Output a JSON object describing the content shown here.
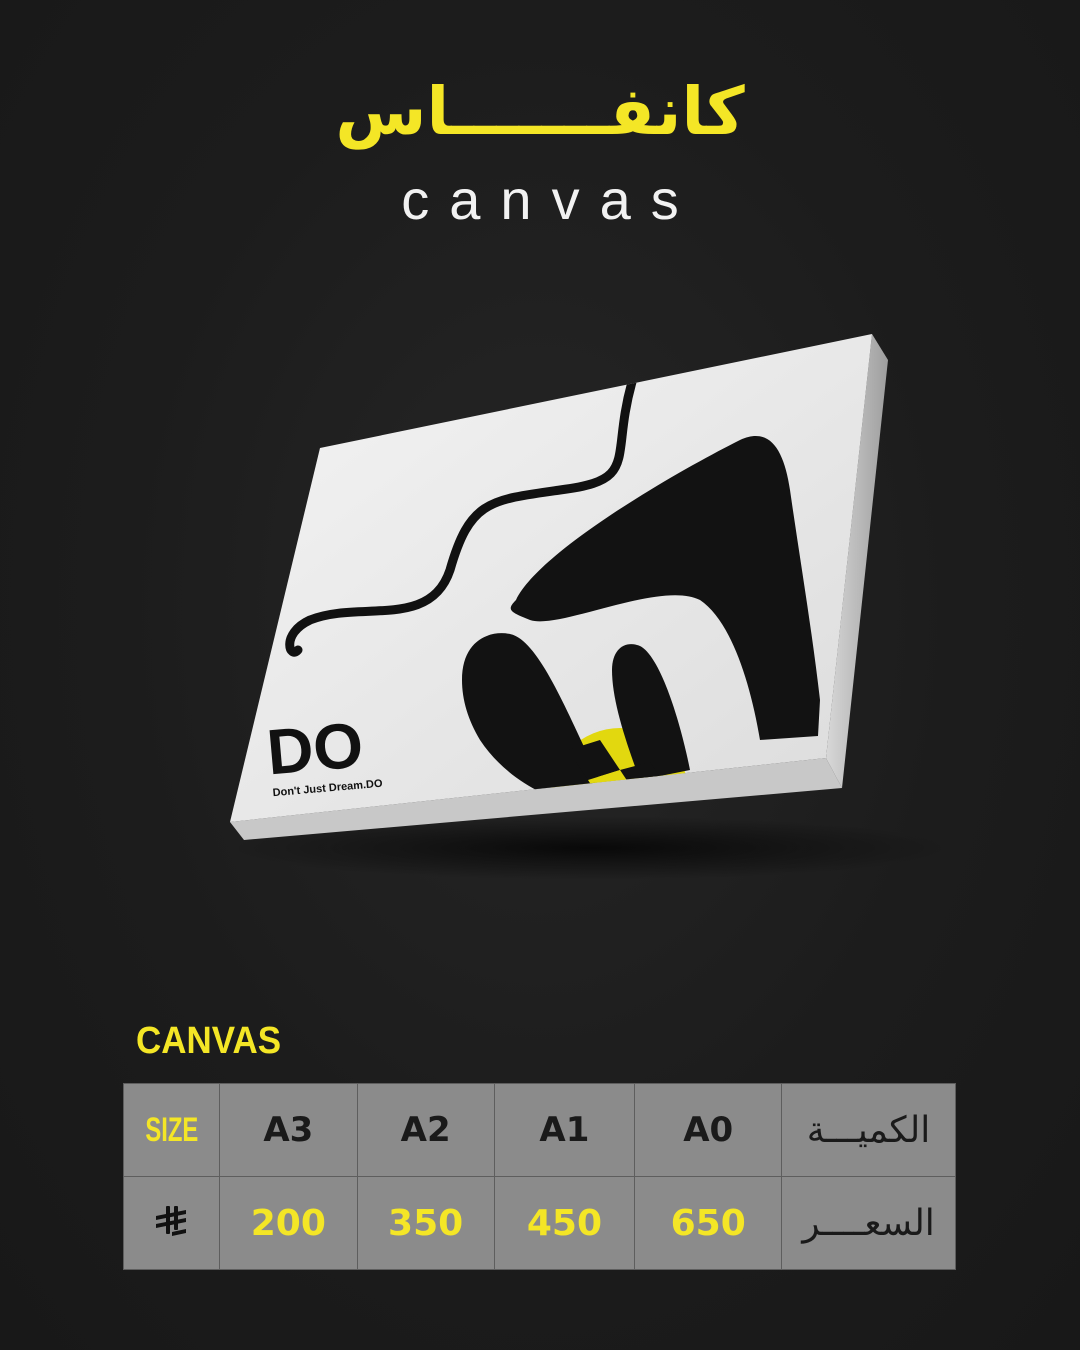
{
  "header": {
    "title_ar": "كانفـــــــاس",
    "title_en": "canvas"
  },
  "product": {
    "brand_logo": "DO",
    "brand_tagline": "Don't Just Dream.DO",
    "accent_color": "#f4e626"
  },
  "pricing": {
    "section_label": "CANVAS",
    "size_label": "SIZE",
    "quantity_label_ar": "الكميـــة",
    "price_label_ar": "السعــــر",
    "currency_icon": "saudi-riyal-icon",
    "sizes": [
      "A3",
      "A2",
      "A1",
      "A0"
    ],
    "prices": [
      "200",
      "350",
      "450",
      "650"
    ]
  }
}
